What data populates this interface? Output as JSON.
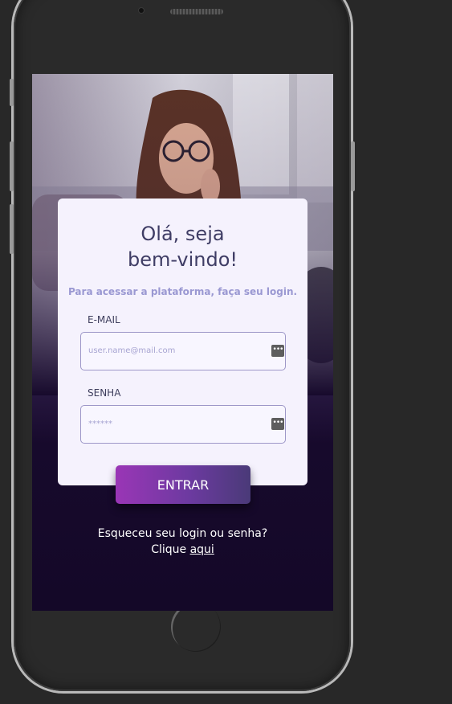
{
  "login": {
    "title_line1": "Olá, seja",
    "title_line2": "bem-vindo!",
    "subtitle": "Para acessar a plataforma, faça seu login.",
    "email_label": "E-MAIL",
    "email_placeholder": "user.name@mail.com",
    "password_label": "SENHA",
    "password_value": "******",
    "submit_label": "ENTRAR",
    "forgot_text": "Esqueceu seu login ou senha?",
    "click_text": "Clique",
    "link_text": "aqui"
  },
  "icons": {
    "field_icon": "password-manager-icon",
    "field_icon_glyph": "•••"
  },
  "colors": {
    "background": "#282828",
    "card": "#f5f2fd",
    "title": "#3f3d65",
    "subtitle": "#9a98d2",
    "button_start": "#9a36b6",
    "button_end": "#4a3a78"
  }
}
